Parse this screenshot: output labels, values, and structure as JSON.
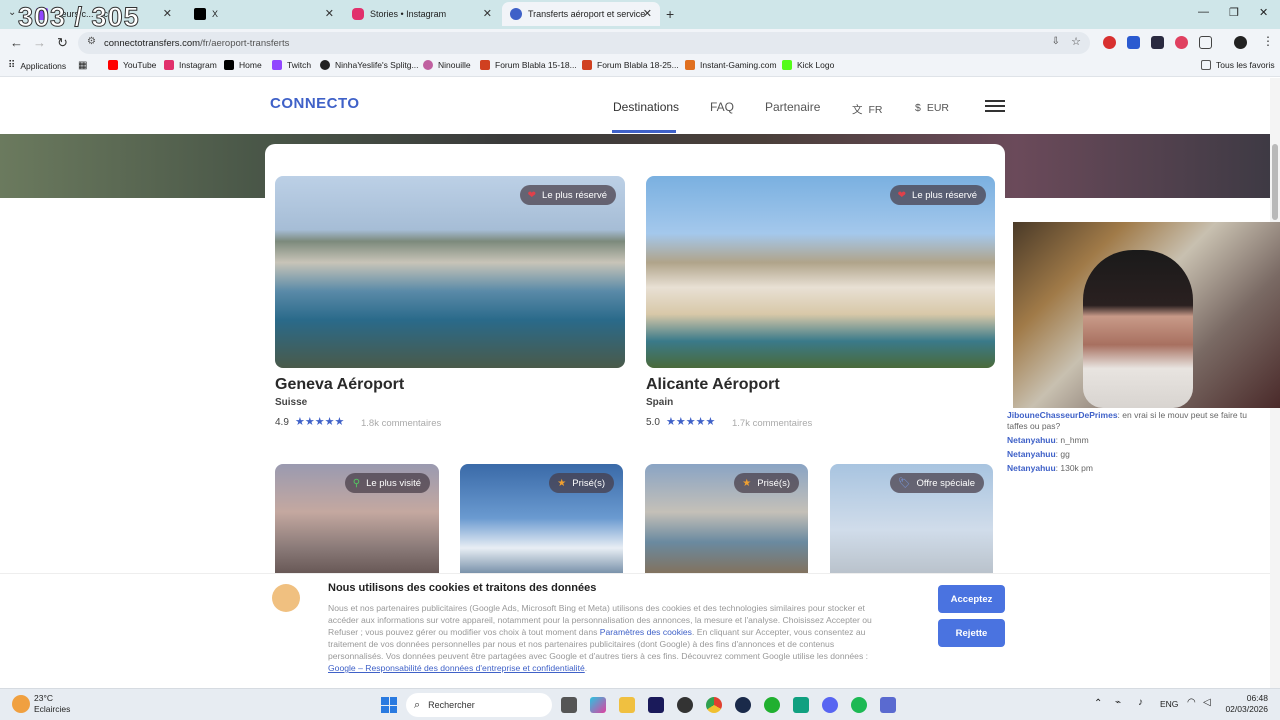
{
  "stream": {
    "counter": "303 / 305"
  },
  "browser": {
    "tabs": [
      {
        "label": "...eurs c... ...ch",
        "favicon_color": "#9146ff"
      },
      {
        "label": "X",
        "favicon_color": "#000000"
      },
      {
        "label": "Stories • Instagram",
        "favicon_color": "#e1306c"
      },
      {
        "label": "Transferts aéroport et service d...",
        "favicon_color": "#3f61c8"
      }
    ],
    "new_tab_icon": "plus-icon",
    "url_domain": "connectotransfers.com",
    "url_path": "/fr/aeroport-transferts",
    "bookmarks_apps": "Applications",
    "bookmarks": [
      {
        "label": "YouTube",
        "color": "#ff0000"
      },
      {
        "label": "Instagram",
        "color": "#e1306c"
      },
      {
        "label": "Home",
        "color": "#000000"
      },
      {
        "label": "Twitch",
        "color": "#9146ff"
      },
      {
        "label": "NinhaYeslife's Splitg...",
        "color": "#222222"
      },
      {
        "label": "Ninouille",
        "color": "#c060a0"
      },
      {
        "label": "Forum Blabla 15-18...",
        "color": "#d04020"
      },
      {
        "label": "Forum Blabla 18-25...",
        "color": "#d04020"
      },
      {
        "label": "Instant-Gaming.com",
        "color": "#e07020"
      },
      {
        "label": "Kick Logo",
        "color": "#53fc18"
      }
    ],
    "all_bookmarks": "Tous les favoris"
  },
  "site": {
    "logo": "CONNECTO",
    "nav": {
      "destinations": "Destinations",
      "faq": "FAQ",
      "partner": "Partenaire",
      "language": "FR",
      "currency": "EUR"
    },
    "accent": "#3f61c8"
  },
  "destinations": [
    {
      "title": "Geneva Aéroport",
      "country": "Suisse",
      "rating": "4.9",
      "stars": "★★★★★",
      "reviews": "1.8k commentaires",
      "badge": "Le plus réservé",
      "badge_icon": "heart-icon"
    },
    {
      "title": "Alicante Aéroport",
      "country": "Spain",
      "rating": "5.0",
      "stars": "★★★★★",
      "reviews": "1.7k commentaires",
      "badge": "Le plus réservé",
      "badge_icon": "heart-icon"
    }
  ],
  "small_cards": [
    {
      "badge": "Le plus visité",
      "badge_icon": "pin-icon"
    },
    {
      "badge": "Prisé(s)",
      "badge_icon": "star-icon"
    },
    {
      "badge": "Prisé(s)",
      "badge_icon": "star-icon"
    },
    {
      "badge": "Offre spéciale",
      "badge_icon": "tag-icon"
    }
  ],
  "cookie": {
    "title": "Nous utilisons des cookies et traitons des données",
    "text_1": "Nous et nos partenaires publicitaires (Google Ads, Microsoft Bing et Meta) utilisons des cookies et des technologies similaires pour stocker et accéder aux informations sur votre appareil, notamment pour la personnalisation des annonces, la mesure et l'analyse. Choisissez Accepter ou Refuser ; vous pouvez gérer ou modifier vos choix à tout moment dans ",
    "link_1": "Paramètres des cookies",
    "text_2": ". En cliquant sur Accepter, vous consentez au traitement de vos données personnelles par nous et nos partenaires publicitaires (dont Google) à des fins d'annonces et de contenus personnalisés. Vos données peuvent être partagées avec Google et d'autres tiers à ces fins. Découvrez comment Google utilise les données : ",
    "link_2": "Google – Responsabilité des données d'entreprise et confidentialité",
    "text_3": ".",
    "accept": "Acceptez",
    "reject": "Rejette"
  },
  "chat": [
    {
      "user": "JibouneChasseurDePrimes",
      "message": ": en vrai si le mouv peut se faire tu taffes ou pas?"
    },
    {
      "user": "Netanyahuu",
      "message": ": n_hmm"
    },
    {
      "user": "Netanyahuu",
      "message": ": gg"
    },
    {
      "user": "Netanyahuu",
      "message": ": 130k pm"
    }
  ],
  "taskbar": {
    "weather_temp": "23°C",
    "weather_desc": "Eclaircies",
    "search_placeholder": "Rechercher",
    "language": "ENG",
    "time": "06:48",
    "date": "02/03/2026"
  }
}
